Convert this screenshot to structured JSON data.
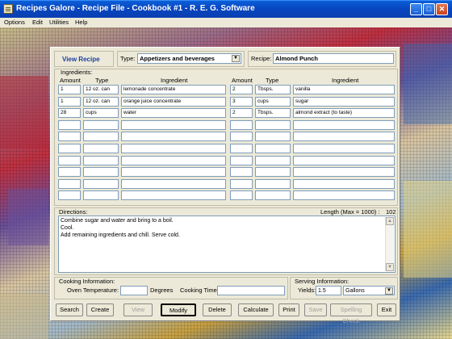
{
  "window": {
    "title": "Recipes Galore - Recipe File - Cookbook #1 - R. E. G. Software",
    "minimize": "_",
    "maximize": "□",
    "close": "✕"
  },
  "menu": [
    "Options",
    "Edit",
    "Utilities",
    "Help"
  ],
  "header": {
    "view_label": "View Recipe",
    "type_label": "Type:",
    "type_value": "Appetizers and beverages",
    "recipe_label": "Recipe:",
    "recipe_value": "Almond Punch"
  },
  "ingredients": {
    "group_label": "Ingredients:",
    "col_amount": "Amount",
    "col_type": "Type",
    "col_ingredient": "Ingredient",
    "left": [
      {
        "amount": "1",
        "type": "12 oz. can",
        "ingredient": "lemonade concentrate"
      },
      {
        "amount": "1",
        "type": "12 oz. can",
        "ingredient": "orange juice concentrate"
      },
      {
        "amount": "28",
        "type": "cups",
        "ingredient": "water"
      },
      {
        "amount": "",
        "type": "",
        "ingredient": ""
      },
      {
        "amount": "",
        "type": "",
        "ingredient": ""
      },
      {
        "amount": "",
        "type": "",
        "ingredient": ""
      },
      {
        "amount": "",
        "type": "",
        "ingredient": ""
      },
      {
        "amount": "",
        "type": "",
        "ingredient": ""
      },
      {
        "amount": "",
        "type": "",
        "ingredient": ""
      },
      {
        "amount": "",
        "type": "",
        "ingredient": ""
      }
    ],
    "right": [
      {
        "amount": "2",
        "type": "Tbsps.",
        "ingredient": "vanilla"
      },
      {
        "amount": "3",
        "type": "cups",
        "ingredient": "sugar"
      },
      {
        "amount": "2",
        "type": "Tbsps.",
        "ingredient": "almond extract (to taste)"
      },
      {
        "amount": "",
        "type": "",
        "ingredient": ""
      },
      {
        "amount": "",
        "type": "",
        "ingredient": ""
      },
      {
        "amount": "",
        "type": "",
        "ingredient": ""
      },
      {
        "amount": "",
        "type": "",
        "ingredient": ""
      },
      {
        "amount": "",
        "type": "",
        "ingredient": ""
      },
      {
        "amount": "",
        "type": "",
        "ingredient": ""
      },
      {
        "amount": "",
        "type": "",
        "ingredient": ""
      }
    ]
  },
  "directions": {
    "label": "Directions:",
    "length_label": "Length (Max = 1000) :",
    "length_value": "102",
    "lines": [
      "Combine sugar and water and bring to a boil.",
      "Cool.",
      "Add remaining ingredients and chill.  Serve cold."
    ]
  },
  "cooking": {
    "group_label": "Cooking Information:",
    "oven_label": "Oven Temperature:",
    "oven_value": "",
    "degrees_label": "Degrees",
    "time_label": "Cooking Time:",
    "time_value": ""
  },
  "serving": {
    "group_label": "Serving Information:",
    "yields_label": "Yields:",
    "yields_value": "1.5",
    "unit_value": "Gallons"
  },
  "buttons": {
    "search": "Search",
    "create": "Create",
    "view": "View",
    "modify": "Modify",
    "delete": "Delete",
    "calculate": "Calculate",
    "print": "Print",
    "save": "Save",
    "spelling": "Spelling Check",
    "exit": "Exit"
  },
  "colors": {
    "titlebar": "#0a4fd0",
    "panel": "#ece9d8",
    "field_border": "#7f9db9",
    "view_label": "#1a3fa0"
  }
}
